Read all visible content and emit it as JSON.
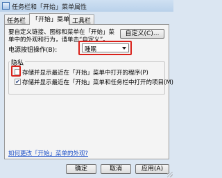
{
  "window": {
    "title": "任务栏和「开始」菜单属性"
  },
  "tabs": [
    {
      "label": "任务栏"
    },
    {
      "label": "「开始」菜单"
    },
    {
      "label": "工具栏"
    }
  ],
  "start_menu": {
    "description": "要自定义链接、图标和菜单在「开始」菜单中的外观和行为，请单击“自定义”。",
    "customize_button": "自定义(C)...",
    "power_button_label": "电源按钮操作(B):",
    "power_button_value": "睡眠"
  },
  "privacy": {
    "title": "隐私",
    "items": [
      {
        "label": "存储并显示最近在「开始」菜单中打开的程序(P)",
        "checked": false,
        "mark": ""
      },
      {
        "label": "存储并显示最近在「开始」菜单和任务栏中打开的项目(M)",
        "checked": true,
        "mark": "✔"
      }
    ]
  },
  "link_text": "如何更改「开始」菜单的外观?",
  "footer": {
    "ok": "确定",
    "cancel": "取消",
    "apply": "应用(A)"
  },
  "colors": {
    "highlight_box": "#d9211a",
    "link": "#1a4ec8"
  }
}
